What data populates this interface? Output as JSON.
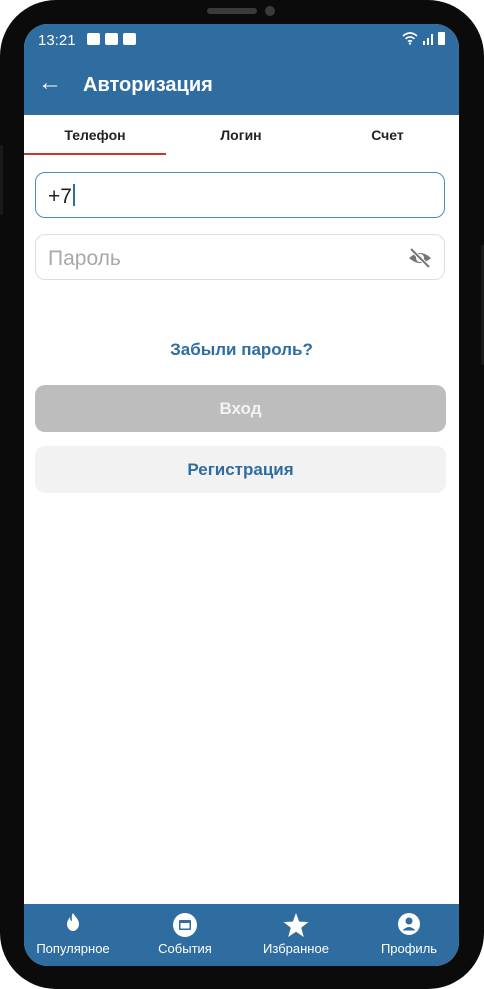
{
  "status_bar": {
    "time": "13:21"
  },
  "app_bar": {
    "title": "Авторизация"
  },
  "tabs": [
    {
      "label": "Телефон",
      "active": true
    },
    {
      "label": "Логин",
      "active": false
    },
    {
      "label": "Счет",
      "active": false
    }
  ],
  "phone_field": {
    "value": "+7"
  },
  "password_field": {
    "placeholder": "Пароль"
  },
  "forgot_link": "Забыли пароль?",
  "login_button": "Вход",
  "register_button": "Регистрация",
  "bottom_nav": [
    {
      "label": "Популярное",
      "icon": "flame-icon"
    },
    {
      "label": "События",
      "icon": "calendar-icon"
    },
    {
      "label": "Избранное",
      "icon": "star-icon"
    },
    {
      "label": "Профиль",
      "icon": "user-icon"
    }
  ],
  "colors": {
    "primary": "#2f6da0",
    "tab_indicator": "#c8372d",
    "disabled_button": "#bdbdbd"
  }
}
